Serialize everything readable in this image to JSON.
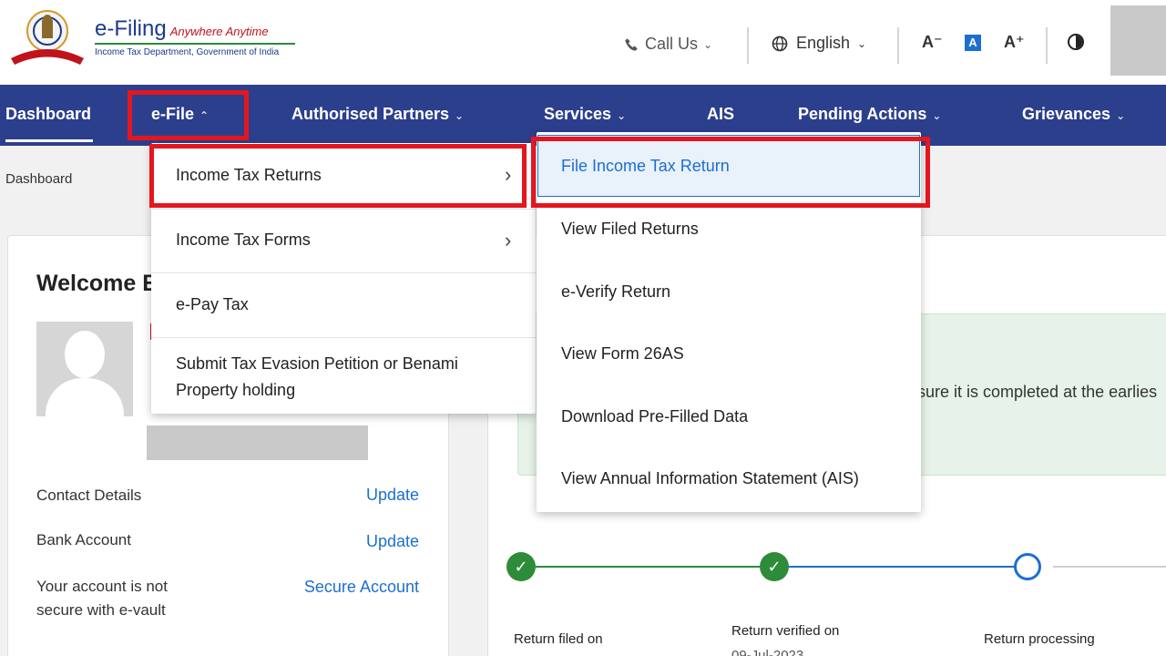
{
  "header": {
    "logo_title": "e-Filing",
    "logo_tagline": "Anywhere Anytime",
    "logo_subtitle": "Income Tax Department, Government of India",
    "call_us": "Call Us",
    "language": "English",
    "font_decrease": "A⁻",
    "font_default": "A",
    "font_increase": "A⁺"
  },
  "nav": {
    "items": [
      {
        "label": "Dashboard"
      },
      {
        "label": "e-File"
      },
      {
        "label": "Authorised Partners"
      },
      {
        "label": "Services"
      },
      {
        "label": "AIS"
      },
      {
        "label": "Pending Actions"
      },
      {
        "label": "Grievances"
      }
    ]
  },
  "breadcrumb": "Dashboard",
  "efile_menu": {
    "items": [
      {
        "label": "Income Tax Returns",
        "has_submenu": true
      },
      {
        "label": "Income Tax Forms",
        "has_submenu": true
      },
      {
        "label": "e-Pay Tax",
        "has_submenu": false
      },
      {
        "label": "Submit Tax Evasion Petition or Benami Property holding",
        "has_submenu": false
      }
    ]
  },
  "itr_submenu": {
    "items": [
      {
        "label": "File Income Tax Return"
      },
      {
        "label": "View Filed Returns"
      },
      {
        "label": "e-Verify Return"
      },
      {
        "label": "View Form 26AS"
      },
      {
        "label": "Download Pre-Filled Data"
      },
      {
        "label": "View Annual Information Statement (AIS)"
      }
    ]
  },
  "profile": {
    "welcome": "Welcome E",
    "contact_label": "Contact Details",
    "contact_action": "Update",
    "bank_label": "Bank Account",
    "bank_action": "Update",
    "secure_label": "Your account is not secure with e-vault",
    "secure_action": "Secure Account"
  },
  "content": {
    "notice_text": "sure it is completed at the earlies",
    "steps": [
      {
        "label": "Return filed on",
        "status": "done"
      },
      {
        "label": "Return verified on",
        "date": "09-Jul-2023",
        "status": "done"
      },
      {
        "label": "Return processing",
        "status": "pending"
      }
    ]
  },
  "colors": {
    "nav_bg": "#2c3f8d",
    "highlight_red": "#e4161e",
    "link_blue": "#1c6fd1",
    "step_green": "#2e8b3a"
  }
}
